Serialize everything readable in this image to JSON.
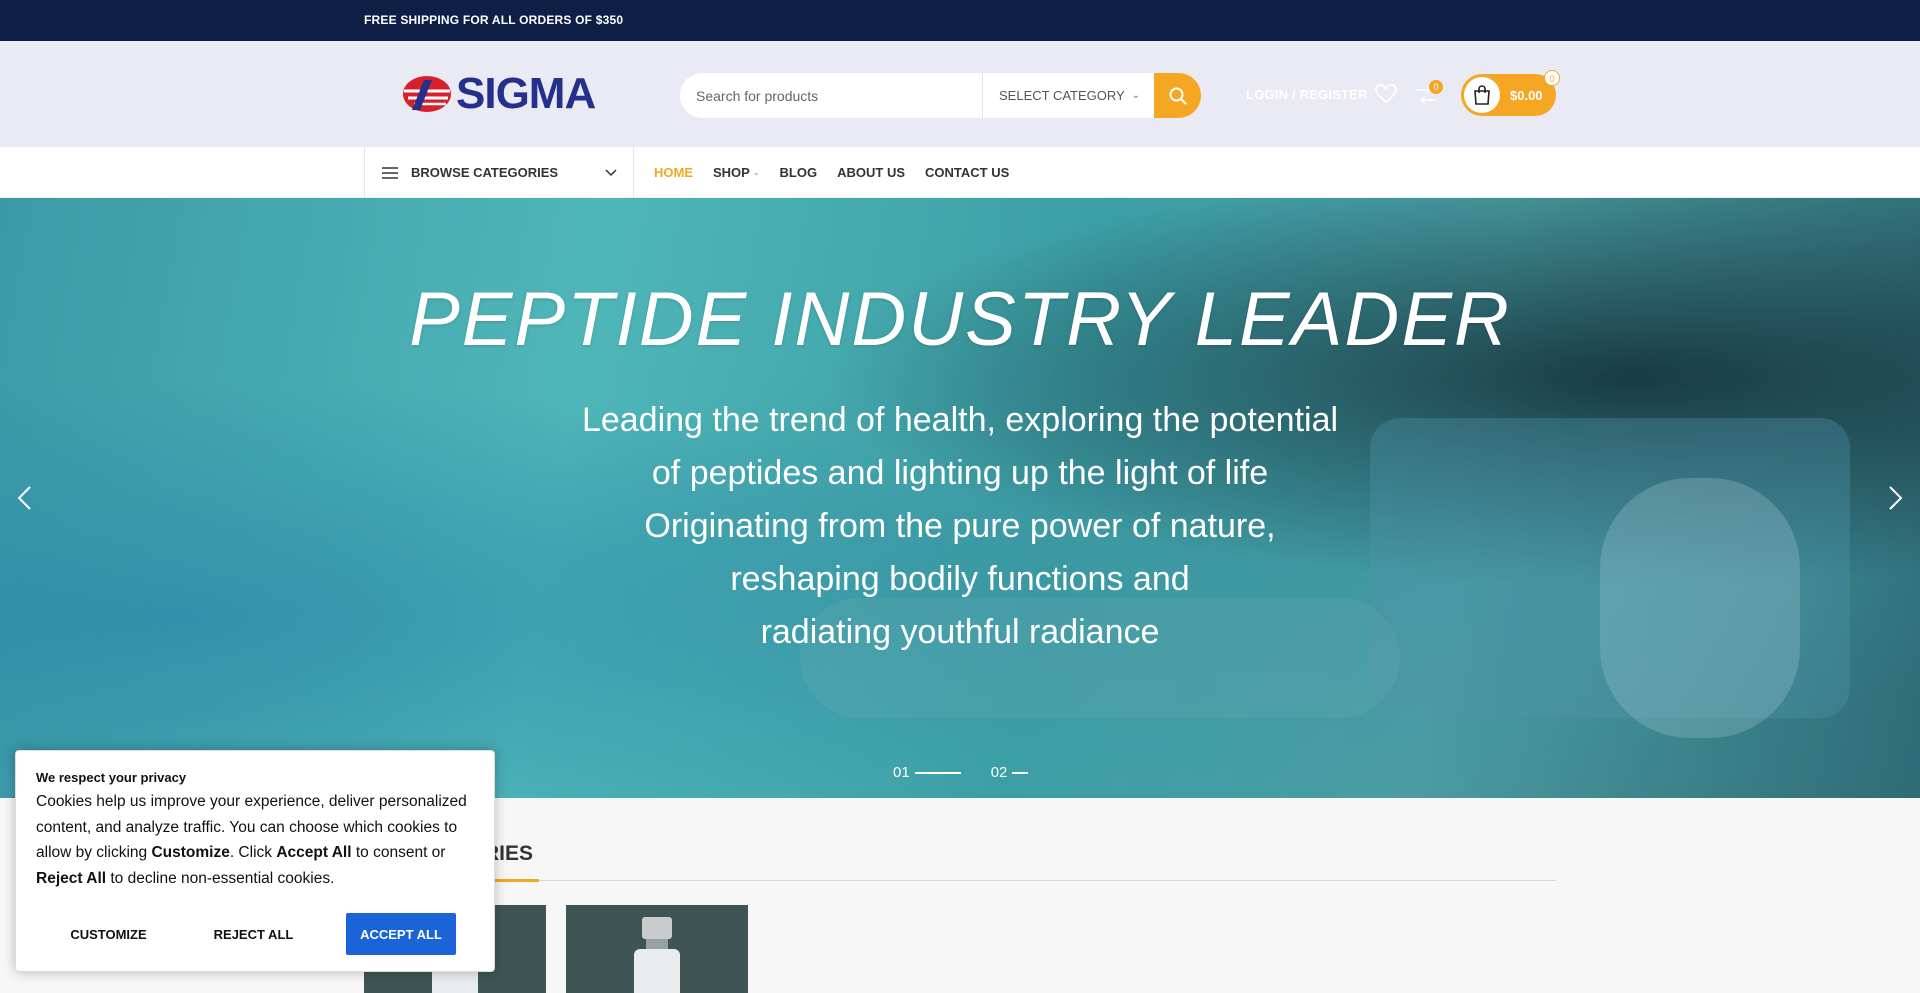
{
  "topbar": {
    "text": "FREE SHIPPING FOR ALL ORDERS OF $350"
  },
  "header": {
    "logo_text": "SIGMA",
    "search": {
      "placeholder": "Search for products",
      "category_label": "SELECT CATEGORY"
    },
    "login_label": "LOGIN / REGISTER",
    "compare_count": "0",
    "cart": {
      "amount": "$0.00",
      "count": "0"
    }
  },
  "navbar": {
    "browse_label": "BROWSE CATEGORIES",
    "items": [
      {
        "label": "HOME"
      },
      {
        "label": "SHOP"
      },
      {
        "label": "BLOG"
      },
      {
        "label": "ABOUT US"
      },
      {
        "label": "CONTACT US"
      }
    ]
  },
  "hero": {
    "title": "PEPTIDE INDUSTRY LEADER",
    "lines": [
      "Leading the trend of health, exploring the potential",
      "of peptides and lighting up the light of life",
      "Originating from the pure power of nature,",
      "reshaping bodily functions and",
      "radiating youthful radiance"
    ],
    "slides": [
      {
        "label": "01"
      },
      {
        "label": "02"
      }
    ]
  },
  "categories": {
    "title_visible": "RIES"
  },
  "cookie": {
    "title": "We respect your privacy",
    "text_1": "Cookies help us improve your experience, deliver personalized content, and analyze traffic. You can choose which cookies to allow by clicking ",
    "bold_customize": "Customize",
    "text_2": ". Click ",
    "bold_accept": "Accept All",
    "text_3": " to consent or ",
    "bold_reject": "Reject All",
    "text_4": " to decline non-essential cookies.",
    "buttons": {
      "customize": "CUSTOMIZE",
      "reject": "REJECT ALL",
      "accept": "ACCEPT ALL"
    }
  },
  "colors": {
    "topbar_bg": "#0f1e45",
    "accent": "#f5a623",
    "brand_blue": "#24308c",
    "accept_button": "#1a63d8"
  }
}
